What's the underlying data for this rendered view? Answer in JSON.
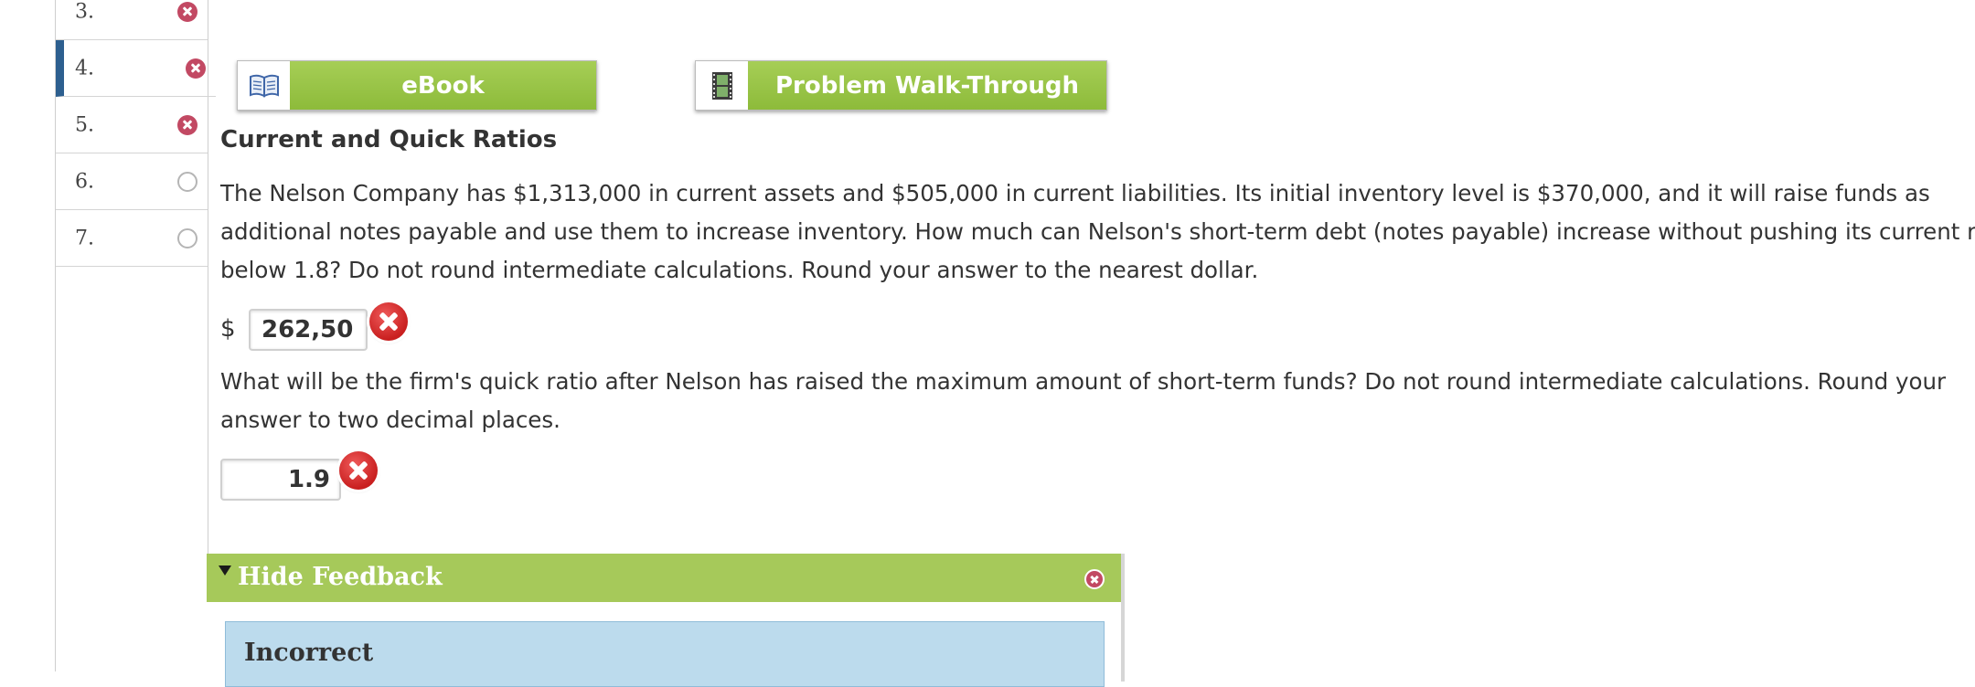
{
  "sidebar": {
    "items": [
      {
        "num": "3.",
        "status": "incorrect"
      },
      {
        "num": "4.",
        "status": "incorrect",
        "active": true
      },
      {
        "num": "5.",
        "status": "incorrect"
      },
      {
        "num": "6.",
        "status": "unanswered"
      },
      {
        "num": "7.",
        "status": "unanswered"
      }
    ]
  },
  "toolbar": {
    "ebook_label": "eBook",
    "walkthrough_label": "Problem Walk-Through"
  },
  "problem": {
    "title": "Current and Quick Ratios",
    "q1_lines": [
      "The Nelson Company has $1,313,000 in current assets and $505,000 in current liabilities. Its initial inventory level is $370,000, and it will raise funds as",
      "additional notes payable and use them to increase inventory. How much can Nelson's short-term debt (notes payable) increase without pushing its current rat",
      "below 1.8? Do not round intermediate calculations. Round your answer to the nearest dollar."
    ],
    "currency_symbol": "$",
    "answer1": "262,50",
    "q2_lines": [
      "What will be the firm's quick ratio after Nelson has raised the maximum amount of short-term funds? Do not round intermediate calculations. Round your",
      "answer to two decimal places."
    ],
    "answer2": "1.9"
  },
  "feedback": {
    "header": "Hide Feedback",
    "result": "Incorrect"
  },
  "colors": {
    "accent_green": "#a6c95a",
    "active_blue": "#2d5f8f",
    "error_red": "#c91f1f",
    "feedback_blue": "#bcdbed"
  }
}
